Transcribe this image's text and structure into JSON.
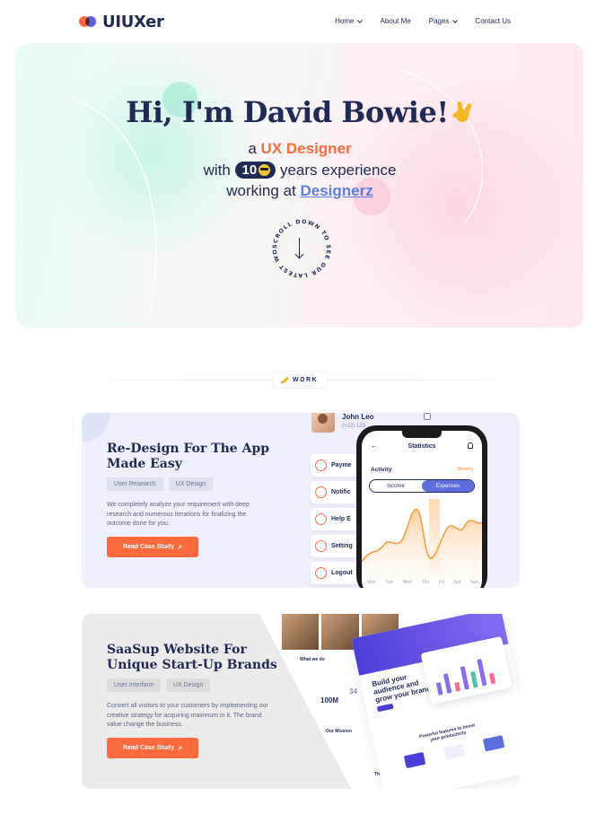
{
  "header": {
    "logo_text": "UIUXer",
    "nav": [
      {
        "label": "Home",
        "has_dropdown": true
      },
      {
        "label": "About Me",
        "has_dropdown": false
      },
      {
        "label": "Pages",
        "has_dropdown": true
      },
      {
        "label": "Contact Us",
        "has_dropdown": false
      }
    ]
  },
  "hero": {
    "title": "Hi, I'm David Bowie!",
    "line1_prefix": "a",
    "line1_role": "UX Designer",
    "line2_prefix": "with",
    "line2_years": "10",
    "line2_suffix": "years experience",
    "line3_prefix": "working at",
    "line3_company": "Designerz",
    "scroll_text": "SCROLL DOWN TO SEE OUR LATEST WORK • "
  },
  "work_section": {
    "label": "WORK"
  },
  "projects": [
    {
      "title": "Re-Design For The App Made Easy",
      "tags": [
        "User Research",
        "UX Design"
      ],
      "description": "We completely analyze your requirement with deep research and numerous iterations for finalizing the outcome done for you.",
      "cta": "Read Case Study",
      "mockup": {
        "profile_name": "John Leo",
        "profile_phone": "(+22) 123",
        "menu": [
          "Payme",
          "Notific",
          "Help E",
          "Setting",
          "Logout"
        ],
        "screen_title": "Statistics",
        "activity_label": "Activity",
        "period": "Weekly",
        "segments": [
          "Income",
          "Expenses"
        ],
        "active_segment": "Expenses",
        "days": [
          "Mon",
          "Tue",
          "Wed",
          "Thu",
          "Fri",
          "Sat",
          "Sun"
        ]
      }
    },
    {
      "title": "SaaSup Website For Unique Start-Up Brands",
      "tags": [
        "User Interface",
        "UX Design"
      ],
      "description": "Convert all visitors to your customers by implementing our creative strategy for acquiring maximum in it. The brand value change the business.",
      "cta": "Read Case Study",
      "mockup": {
        "what_we_do": "What we do",
        "stat": "100M",
        "stat2": "34",
        "mission": "Our Mission",
        "headline": "Build your audience and grow your brand",
        "features": "Powerful features to boost your productivity",
        "footer_word": "The"
      }
    }
  ],
  "colors": {
    "navy": "#1f2a55",
    "orange": "#ff6a3d",
    "blue_link": "#5b7fe8",
    "purple": "#5b6fe0"
  }
}
